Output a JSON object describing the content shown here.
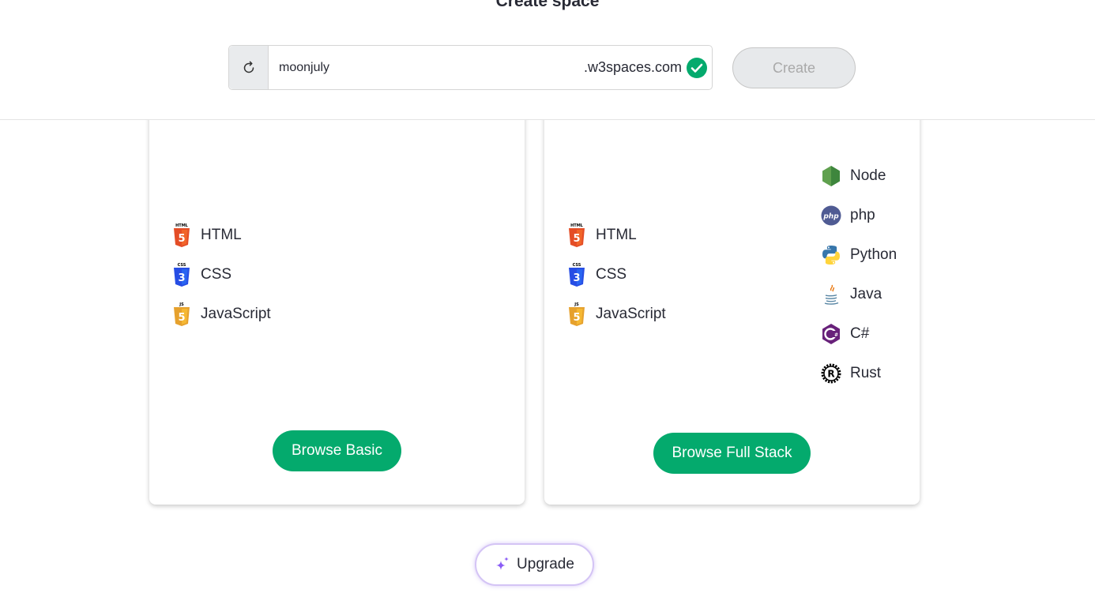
{
  "header": {
    "title": "Create space",
    "subdomain_value": "moonjuly",
    "domain_suffix": ".w3spaces.com",
    "create_label": "Create"
  },
  "cards": {
    "basic": {
      "languages": [
        "HTML",
        "CSS",
        "JavaScript"
      ],
      "button_label": "Browse Basic"
    },
    "full_stack": {
      "frontend": [
        "HTML",
        "CSS",
        "JavaScript"
      ],
      "backend": [
        "Node",
        "php",
        "Python",
        "Java",
        "C#",
        "Rust"
      ],
      "button_label": "Browse Full Stack"
    }
  },
  "upgrade_label": "Upgrade",
  "icon_badges": {
    "html": "HTML",
    "css": "CSS",
    "js": "JS",
    "php": "php",
    "csharp": "C#",
    "rust": "R"
  },
  "colors": {
    "accent_green": "#04aa6d",
    "html": "#e44d26",
    "css": "#264de4",
    "js": "#f0a22f",
    "node": "#5fa04e",
    "php": "#4f5b93",
    "python_blue": "#3776ab",
    "python_yellow": "#ffd43b",
    "csharp": "#68217a",
    "upgrade_border": "#d4c4f5"
  }
}
